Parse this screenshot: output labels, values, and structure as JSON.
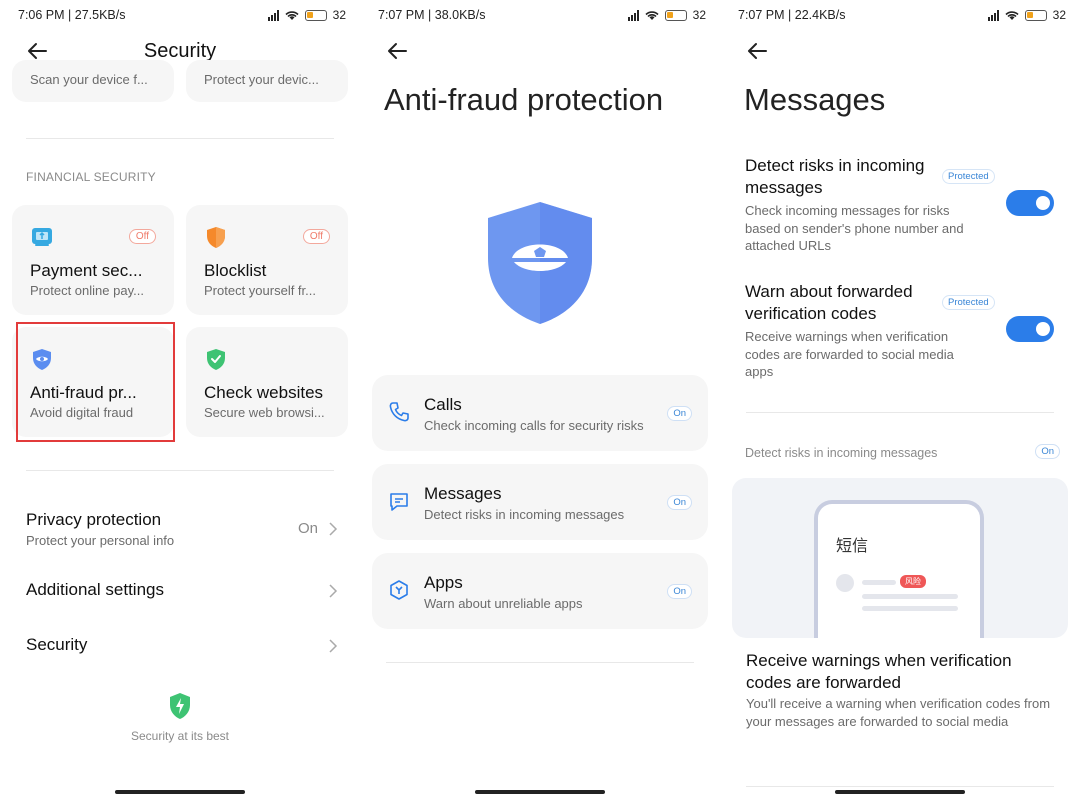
{
  "screen1": {
    "status": {
      "time": "7:06 PM | 27.5KB/s",
      "battery": "32"
    },
    "title": "Security",
    "top_cards": [
      {
        "subtitle": "Scan your device f..."
      },
      {
        "subtitle": "Protect your devic..."
      }
    ],
    "section_label": "FINANCIAL SECURITY",
    "cards": [
      {
        "title": "Payment sec...",
        "subtitle": "Protect online pay...",
        "badge": "Off",
        "icon": "payment-shield-icon",
        "color": "#36a9e1"
      },
      {
        "title": "Blocklist",
        "subtitle": "Protect yourself fr...",
        "badge": "Off",
        "icon": "orange-shield-icon",
        "color": "#f5892a"
      },
      {
        "title": "Anti-fraud pr...",
        "subtitle": "Avoid digital fraud",
        "icon": "blue-shield-eye-icon",
        "color": "#5b8df0"
      },
      {
        "title": "Check websites",
        "subtitle": "Secure web browsi...",
        "icon": "green-shield-check-icon",
        "color": "#3ec373"
      }
    ],
    "rows": [
      {
        "title": "Privacy protection",
        "subtitle": "Protect your personal info",
        "value": "On"
      },
      {
        "title": "Additional settings"
      },
      {
        "title": "Security"
      }
    ],
    "footer": "Security at its best"
  },
  "screen2": {
    "status": {
      "time": "7:07 PM | 38.0KB/s",
      "battery": "32"
    },
    "title": "Anti-fraud protection",
    "features": [
      {
        "title": "Calls",
        "subtitle": "Check incoming calls for security risks",
        "badge": "On",
        "icon": "phone-icon"
      },
      {
        "title": "Messages",
        "subtitle": "Detect risks in incoming messages",
        "badge": "On",
        "icon": "message-icon"
      },
      {
        "title": "Apps",
        "subtitle": "Warn about unreliable apps",
        "badge": "On",
        "icon": "app-hexagon-icon"
      }
    ]
  },
  "screen3": {
    "status": {
      "time": "7:07 PM | 22.4KB/s",
      "battery": "32"
    },
    "title": "Messages",
    "settings": [
      {
        "title": "Detect risks in incoming messages",
        "subtitle": "Check incoming messages for risks based on sender's phone number and attached URLs",
        "badge": "Protected",
        "enabled": true
      },
      {
        "title": "Warn about forwarded verification codes",
        "subtitle": "Receive warnings when verification codes are forwarded to social media apps",
        "badge": "Protected",
        "enabled": true
      }
    ],
    "sub_label": "Detect risks in incoming messages",
    "sub_badge": "On",
    "demo": {
      "phone_title": "短信",
      "tag": "风险"
    },
    "warn_title": "Receive warnings when verification codes are forwarded",
    "warn_desc": "You'll receive a warning when verification codes from your messages are forwarded to social media"
  },
  "colors": {
    "accent": "#2b7de9",
    "highlight": "#e23b3b"
  }
}
